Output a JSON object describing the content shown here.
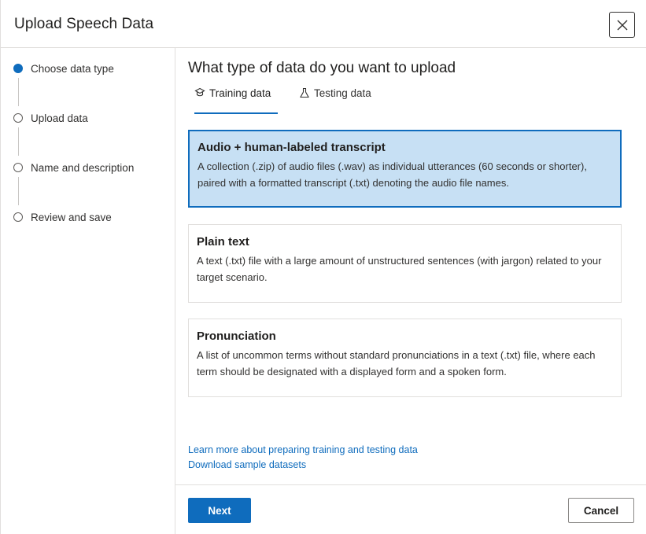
{
  "dialog": {
    "title": "Upload Speech Data",
    "close_icon": "close-icon"
  },
  "steps": [
    {
      "label": "Choose data type",
      "state": "active"
    },
    {
      "label": "Upload data",
      "state": "pending"
    },
    {
      "label": "Name and description",
      "state": "pending"
    },
    {
      "label": "Review and save",
      "state": "pending"
    }
  ],
  "main": {
    "heading": "What type of data do you want to upload",
    "tabs": [
      {
        "label": "Training data",
        "icon": "training-icon",
        "selected": true
      },
      {
        "label": "Testing data",
        "icon": "flask-icon",
        "selected": false
      }
    ],
    "cards": [
      {
        "title": "Audio + human-labeled transcript",
        "description": "A collection (.zip) of audio files (.wav) as individual utterances (60 seconds or shorter), paired with a formatted transcript (.txt) denoting the audio file names.",
        "selected": true
      },
      {
        "title": "Plain text",
        "description": "A text (.txt) file with a large amount of unstructured sentences (with jargon) related to your target scenario.",
        "selected": false
      },
      {
        "title": "Pronunciation",
        "description": "A list of uncommon terms without standard pronunciations in a text (.txt) file, where each term should be designated with a displayed form and a spoken form.",
        "selected": false
      }
    ],
    "links": [
      "Learn more about preparing training and testing data",
      "Download sample datasets"
    ]
  },
  "footer": {
    "next_label": "Next",
    "cancel_label": "Cancel"
  },
  "colors": {
    "accent": "#0f6cbd",
    "selected_card_bg": "#c7e0f4",
    "border": "#e1dfdd"
  }
}
